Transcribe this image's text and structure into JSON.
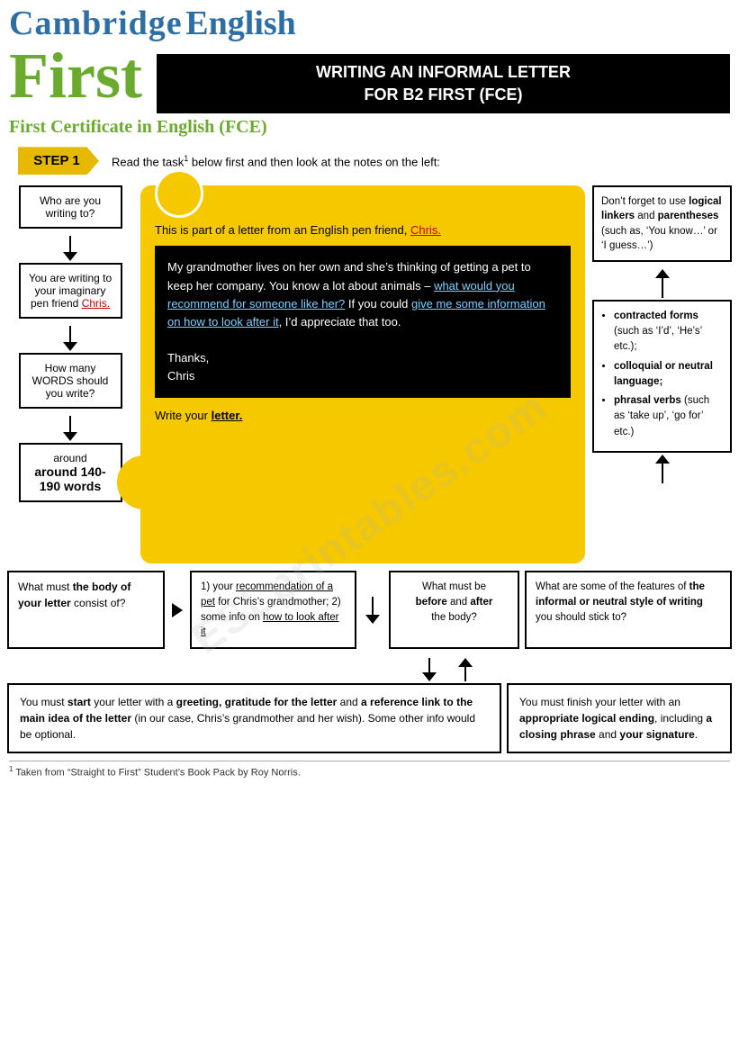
{
  "header": {
    "cambridge": "Cambridge",
    "english": "English",
    "first": "First",
    "title_line1": "WRITING AN INFORMAL LETTER",
    "title_line2": "FOR B2 FIRST (FCE)",
    "fce_subtitle": "First Certificate in English (FCE)"
  },
  "step1": {
    "label": "STEP 1",
    "instruction": "Read the task",
    "sup": "1",
    "instruction2": " below first and then look at the notes on the left:"
  },
  "left_notes": {
    "box1": "Who are you writing to?",
    "box2_line1": "You are writing to your imaginary pen friend",
    "box2_chris": "Chris.",
    "box3": "How many WORDS should you write?",
    "box4": "around 140-190 words"
  },
  "letter": {
    "intro": "This is part of a letter from an English pen friend,",
    "chris": "Chris.",
    "body_p1": "My grandmother lives on her own and she’s thinking of getting a pet to keep her company. You know a lot about animals – ",
    "body_underline1": "what would you recommend for someone like her?",
    "body_p2": " If you could ",
    "body_underline2": "give me some information on how to look after it",
    "body_p3": ", I’d appreciate that too.",
    "thanks": "Thanks,",
    "sign": "Chris",
    "write_instruction": "Write your",
    "write_word": "letter."
  },
  "right_notes": {
    "box_top": "Don’t forget to use logical linkers and parentheses (such as, ‘You know…’ or ‘I guess…’)",
    "box_bottom_items": [
      "contracted forms (such as ‘I’d’, ‘He’s’ etc.);",
      "colloquial or neutral language;",
      "phrasal verbs (such as ‘take up’, ‘go for’ etc.)"
    ]
  },
  "bottom_boxes": {
    "left": {
      "text1": "What must ",
      "text2": "the body of your letter",
      "text3": " consist of?"
    },
    "mid1": {
      "text": "1) your recommendation of a pet for Chris’s grandmother; 2) some info on how to look after it",
      "underline1": "recommendation of a pet",
      "underline2": "how to look after it"
    },
    "mid2": {
      "label1": "What must be",
      "label2": "before",
      "label3": "and",
      "label4": "after",
      "label5": "the body?"
    },
    "right": {
      "text1": "What are some of the features of ",
      "text2": "the informal or neutral style of writing",
      "text3": " you should stick to?"
    }
  },
  "very_bottom": {
    "left": "You must start your letter with a greeting, gratitude for the letter and a reference link to the main idea of the letter (in our case, Chris’s grandmother and her wish). Some other info would be optional.",
    "right": "You must finish your letter with an appropriate logical ending, including a closing phrase and your signature."
  },
  "footnote": "Taken from “Straight to First” Student’s Book Pack by Roy Norris."
}
